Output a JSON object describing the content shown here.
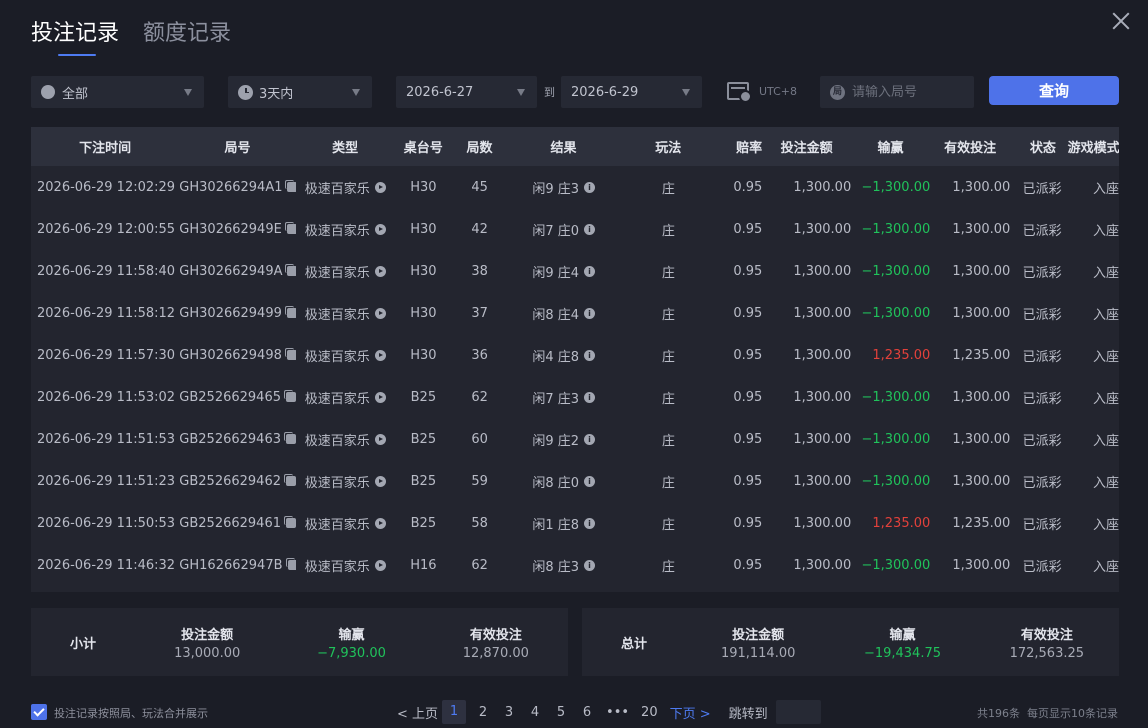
{
  "tabs": [
    "投注记录",
    "额度记录"
  ],
  "filters": {
    "game": "全部",
    "period": "3天内",
    "date_from": "2026-6-27",
    "to_label": "到",
    "date_to": "2026-6-29",
    "timezone": "UTC+8",
    "round_placeholder": "请输入局号",
    "round_icon": "局",
    "query_label": "查询"
  },
  "table": {
    "headers": [
      "下注时间",
      "局号",
      "类型",
      "桌台号",
      "局数",
      "结果",
      "玩法",
      "赔率",
      "投注金额",
      "输赢",
      "有效投注",
      "状态",
      "游戏模式"
    ],
    "rows": [
      {
        "time": "2026-06-29 12:02:29",
        "round": "GH30266294A1",
        "type": "极速百家乐",
        "table": "H30",
        "num": "45",
        "result": "闲9 庄3",
        "play": "庄",
        "odds": "0.95",
        "amount": "1,300.00",
        "win": "−1,300.00",
        "win_color": "#20c25b",
        "valid": "1,300.00",
        "status": "已派彩",
        "mode": "入座"
      },
      {
        "time": "2026-06-29 12:00:55",
        "round": "GH302662949E",
        "type": "极速百家乐",
        "table": "H30",
        "num": "42",
        "result": "闲7 庄0",
        "play": "庄",
        "odds": "0.95",
        "amount": "1,300.00",
        "win": "−1,300.00",
        "win_color": "#20c25b",
        "valid": "1,300.00",
        "status": "已派彩",
        "mode": "入座"
      },
      {
        "time": "2026-06-29 11:58:40",
        "round": "GH302662949A",
        "type": "极速百家乐",
        "table": "H30",
        "num": "38",
        "result": "闲9 庄4",
        "play": "庄",
        "odds": "0.95",
        "amount": "1,300.00",
        "win": "−1,300.00",
        "win_color": "#20c25b",
        "valid": "1,300.00",
        "status": "已派彩",
        "mode": "入座"
      },
      {
        "time": "2026-06-29 11:58:12",
        "round": "GH3026629499",
        "type": "极速百家乐",
        "table": "H30",
        "num": "37",
        "result": "闲8 庄4",
        "play": "庄",
        "odds": "0.95",
        "amount": "1,300.00",
        "win": "−1,300.00",
        "win_color": "#20c25b",
        "valid": "1,300.00",
        "status": "已派彩",
        "mode": "入座"
      },
      {
        "time": "2026-06-29 11:57:30",
        "round": "GH3026629498",
        "type": "极速百家乐",
        "table": "H30",
        "num": "36",
        "result": "闲4 庄8",
        "play": "庄",
        "odds": "0.95",
        "amount": "1,300.00",
        "win": "1,235.00",
        "win_color": "#e2413b",
        "valid": "1,235.00",
        "status": "已派彩",
        "mode": "入座"
      },
      {
        "time": "2026-06-29 11:53:02",
        "round": "GB2526629465",
        "type": "极速百家乐",
        "table": "B25",
        "num": "62",
        "result": "闲7 庄3",
        "play": "庄",
        "odds": "0.95",
        "amount": "1,300.00",
        "win": "−1,300.00",
        "win_color": "#20c25b",
        "valid": "1,300.00",
        "status": "已派彩",
        "mode": "入座"
      },
      {
        "time": "2026-06-29 11:51:53",
        "round": "GB2526629463",
        "type": "极速百家乐",
        "table": "B25",
        "num": "60",
        "result": "闲9 庄2",
        "play": "庄",
        "odds": "0.95",
        "amount": "1,300.00",
        "win": "−1,300.00",
        "win_color": "#20c25b",
        "valid": "1,300.00",
        "status": "已派彩",
        "mode": "入座"
      },
      {
        "time": "2026-06-29 11:51:23",
        "round": "GB2526629462",
        "type": "极速百家乐",
        "table": "B25",
        "num": "59",
        "result": "闲8 庄0",
        "play": "庄",
        "odds": "0.95",
        "amount": "1,300.00",
        "win": "−1,300.00",
        "win_color": "#20c25b",
        "valid": "1,300.00",
        "status": "已派彩",
        "mode": "入座"
      },
      {
        "time": "2026-06-29 11:50:53",
        "round": "GB2526629461",
        "type": "极速百家乐",
        "table": "B25",
        "num": "58",
        "result": "闲1 庄8",
        "play": "庄",
        "odds": "0.95",
        "amount": "1,300.00",
        "win": "1,235.00",
        "win_color": "#e2413b",
        "valid": "1,235.00",
        "status": "已派彩",
        "mode": "入座"
      },
      {
        "time": "2026-06-29 11:46:32",
        "round": "GH162662947B",
        "type": "极速百家乐",
        "table": "H16",
        "num": "62",
        "result": "闲8 庄3",
        "play": "庄",
        "odds": "0.95",
        "amount": "1,300.00",
        "win": "−1,300.00",
        "win_color": "#20c25b",
        "valid": "1,300.00",
        "status": "已派彩",
        "mode": "入座"
      }
    ]
  },
  "subtotal": {
    "label": "小计",
    "amount_label": "投注金额",
    "amount": "13,000.00",
    "win_label": "输赢",
    "win": "−7,930.00",
    "valid_label": "有效投注",
    "valid": "12,870.00"
  },
  "total": {
    "label": "总计",
    "amount_label": "投注金额",
    "amount": "191,114.00",
    "win_label": "输赢",
    "win": "−19,434.75",
    "valid_label": "有效投注",
    "valid": "172,563.25"
  },
  "footer": {
    "merge_label": "投注记录按照局、玩法合并展示",
    "merge_checked": true,
    "prev": "< 上页",
    "pages": [
      "1",
      "2",
      "3",
      "4",
      "5",
      "6",
      "•••",
      "20"
    ],
    "current_page": "1",
    "next": "下页 >",
    "jump_label": "跳转到",
    "total_count": "共196条",
    "per_page": "每页显示10条记录"
  },
  "colors": {
    "accent": "#4e72e9",
    "win_negative": "#20c25b",
    "win_positive": "#e2413b",
    "background": "#1b1d26"
  }
}
